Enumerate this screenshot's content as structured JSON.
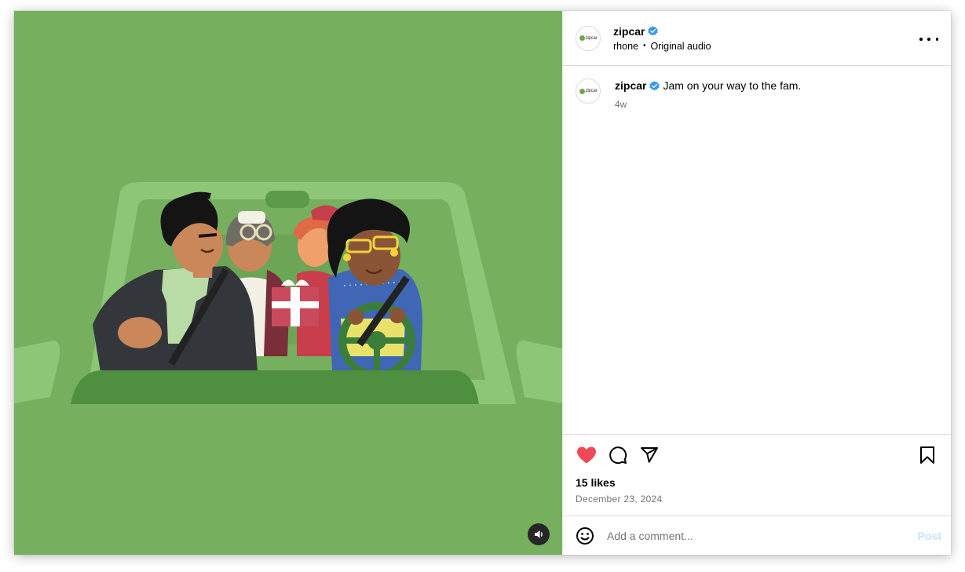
{
  "post": {
    "account": {
      "username": "zipcar",
      "avatar_logo_text": "zipcar",
      "verified": true,
      "verified_icon": "verified-badge-icon",
      "verified_color": "#3897f0"
    },
    "audio": {
      "artist": "rhone",
      "separator": "•",
      "label": "Original audio"
    },
    "more_icon": "more-horizontal-icon",
    "caption": {
      "username": "zipcar",
      "text": "Jam on your way to the fam.",
      "time": "4w"
    },
    "actions": {
      "like_icon": "heart-filled-icon",
      "like_color": "#ed4956",
      "liked": true,
      "comment_icon": "comment-icon",
      "share_icon": "share-icon",
      "save_icon": "bookmark-icon"
    },
    "likes_text": "15 likes",
    "date": "December 23, 2024",
    "comment_box": {
      "emoji_icon": "emoji-icon",
      "placeholder": "Add a comment...",
      "post_label": "Post",
      "post_color": "#c6e3fb"
    },
    "media": {
      "type": "video",
      "background_color": "#76af5e",
      "mute_icon": "volume-icon"
    }
  }
}
